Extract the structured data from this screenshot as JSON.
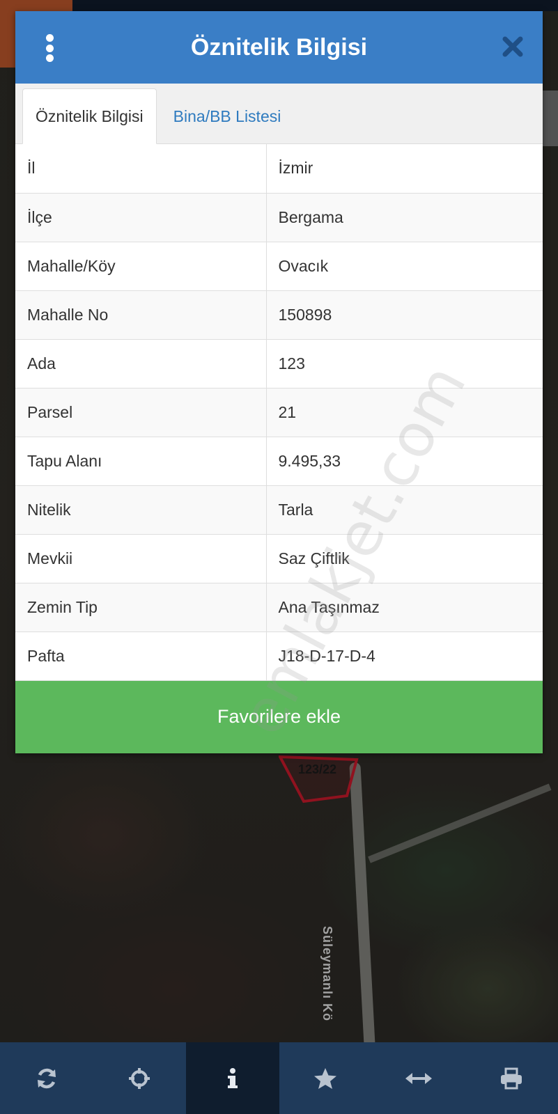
{
  "dialog": {
    "title": "Öznitelik Bilgisi",
    "tabs": [
      {
        "label": "Öznitelik Bilgisi",
        "active": true
      },
      {
        "label": "Bina/BB Listesi",
        "active": false
      }
    ],
    "rows": [
      {
        "key": "İl",
        "value": "İzmir"
      },
      {
        "key": "İlçe",
        "value": "Bergama"
      },
      {
        "key": "Mahalle/Köy",
        "value": "Ovacık"
      },
      {
        "key": "Mahalle No",
        "value": "150898"
      },
      {
        "key": "Ada",
        "value": "123"
      },
      {
        "key": "Parsel",
        "value": "21"
      },
      {
        "key": "Tapu Alanı",
        "value": "9.495,33"
      },
      {
        "key": "Nitelik",
        "value": "Tarla"
      },
      {
        "key": "Mevkii",
        "value": "Saz Çiftlik"
      },
      {
        "key": "Zemin Tip",
        "value": "Ana Taşınmaz"
      },
      {
        "key": "Pafta",
        "value": "J18-D-17-D-4"
      }
    ],
    "favorite_button": "Favorilere ekle"
  },
  "watermark": "emlakjet.com",
  "map": {
    "parcel_label": "123/22",
    "road_label": "Süleymanlı Kö"
  },
  "toolbar": {
    "items": [
      {
        "icon": "refresh-icon",
        "active": false
      },
      {
        "icon": "crosshair-icon",
        "active": false
      },
      {
        "icon": "info-icon",
        "active": true
      },
      {
        "icon": "star-icon",
        "active": false
      },
      {
        "icon": "horizontal-arrows-icon",
        "active": false
      },
      {
        "icon": "print-icon",
        "active": false
      }
    ]
  },
  "colors": {
    "header": "#3a7ec6",
    "button": "#5cb85c",
    "toolbar": "#1f3a5a",
    "toolbar_active": "#0f1d2e",
    "tab_link": "#2f7bbf"
  }
}
